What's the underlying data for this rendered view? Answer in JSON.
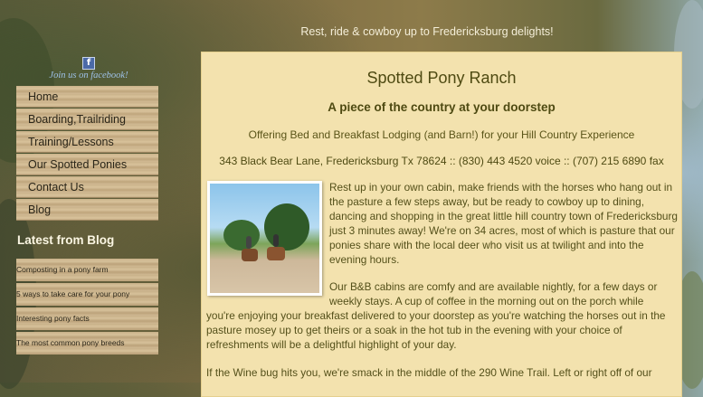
{
  "header": {
    "tagline": "Rest, ride & cowboy up to Fredericksburg delights!"
  },
  "facebook": {
    "icon": "facebook-icon",
    "label": "Join us on facebook!"
  },
  "nav": {
    "items": [
      {
        "label": "Home"
      },
      {
        "label": "Boarding,Trailriding"
      },
      {
        "label": "Training/Lessons"
      },
      {
        "label": "Our Spotted Ponies"
      },
      {
        "label": "Contact Us"
      },
      {
        "label": "Blog"
      }
    ]
  },
  "blog": {
    "heading": "Latest from Blog",
    "posts": [
      {
        "title": "Composting in a pony farm"
      },
      {
        "title": "5 ways to take care for your pony"
      },
      {
        "title": "Interesting pony facts"
      },
      {
        "title": "The most common pony breeds"
      }
    ]
  },
  "main": {
    "title": "Spotted Pony Ranch",
    "subtitle": "A piece of the country at your doorstep",
    "offer": "Offering Bed and Breakfast Lodging (and Barn!)  for your Hill Country Experience",
    "address": "343 Black Bear Lane, Fredericksburg Tx 78624 :: (830) 443 4520 voice :: (707) 215 6890 fax",
    "paragraph1": "Rest up in your own cabin, make friends with the horses who hang out in the pasture a few steps away, but be ready to cowboy up to dining, dancing and shopping in the great little hill country town of Fredericksburg just 3 minutes away! We're on 34 acres, most of which is pasture that our ponies share with the local deer who visit us at twilight and into the evening hours.",
    "paragraph2_top": "Our B&B cabins are comfy and are  available nightly, for a few days or weekly  stays. A cup of coffee in the morning out on the porch while",
    "paragraph2_bottom": "you're enjoying your breakfast delivered to your doorstep as you're watching the horses out in the pasture mosey up to get theirs or a soak in the hot tub in the evening with your choice of refreshments will be a delightful highlight of your day.",
    "paragraph3": "If the Wine bug hits you, we're smack in the middle of the 290 Wine Trail. Left or right off of our"
  }
}
